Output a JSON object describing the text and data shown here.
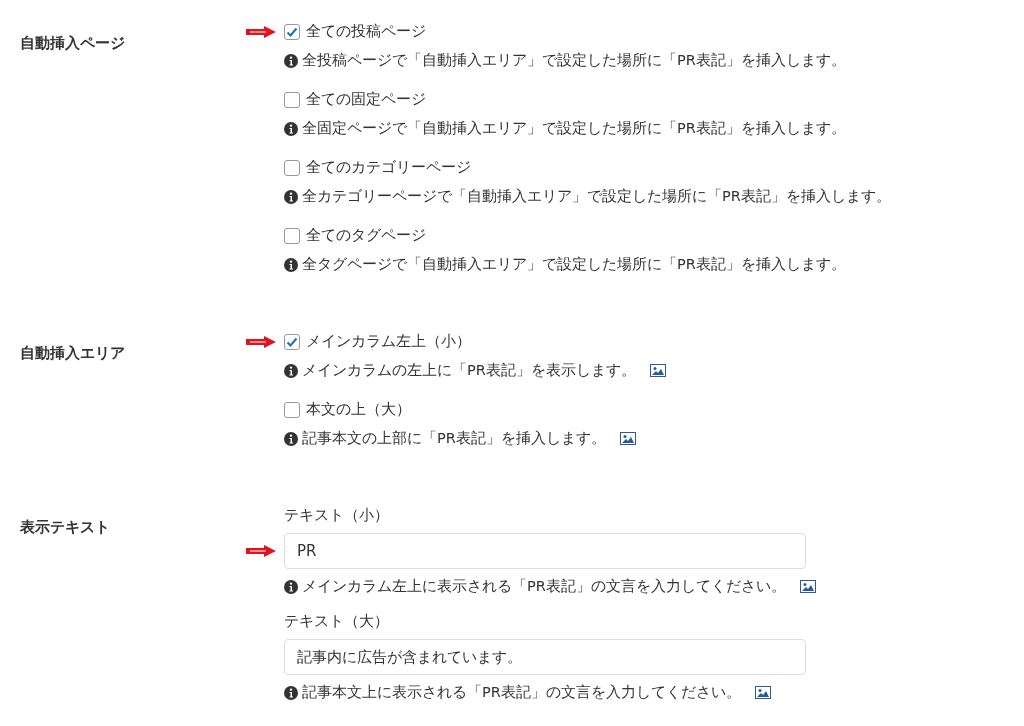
{
  "sections": [
    {
      "label": "自動挿入ページ",
      "kind": "checkboxes",
      "options": [
        {
          "label": "全ての投稿ページ",
          "checked": true,
          "pointer": true,
          "hint": "全投稿ページで「自動挿入エリア」で設定した場所に「PR表記」を挿入します。",
          "image_icon": false
        },
        {
          "label": "全ての固定ページ",
          "checked": false,
          "pointer": false,
          "hint": "全固定ページで「自動挿入エリア」で設定した場所に「PR表記」を挿入します。",
          "image_icon": false
        },
        {
          "label": "全てのカテゴリーページ",
          "checked": false,
          "pointer": false,
          "hint": "全カテゴリーページで「自動挿入エリア」で設定した場所に「PR表記」を挿入します。",
          "image_icon": false
        },
        {
          "label": "全てのタグページ",
          "checked": false,
          "pointer": false,
          "hint": "全タグページで「自動挿入エリア」で設定した場所に「PR表記」を挿入します。",
          "image_icon": false
        }
      ]
    },
    {
      "label": "自動挿入エリア",
      "kind": "checkboxes",
      "options": [
        {
          "label": "メインカラム左上（小）",
          "checked": true,
          "pointer": true,
          "hint": "メインカラムの左上に「PR表記」を表示します。",
          "image_icon": true
        },
        {
          "label": "本文の上（大）",
          "checked": false,
          "pointer": false,
          "hint": "記事本文の上部に「PR表記」を挿入します。",
          "image_icon": true
        }
      ]
    },
    {
      "label": "表示テキスト",
      "kind": "fields",
      "fields": [
        {
          "label": "テキスト（小）",
          "value": "PR",
          "pointer": true,
          "hint": "メインカラム左上に表示される「PR表記」の文言を入力してください。",
          "image_icon": true
        },
        {
          "label": "テキスト（大）",
          "value": "記事内に広告が含まれています。",
          "pointer": false,
          "hint": "記事本文上に表示される「PR表記」の文言を入力してください。",
          "image_icon": true
        }
      ]
    }
  ]
}
